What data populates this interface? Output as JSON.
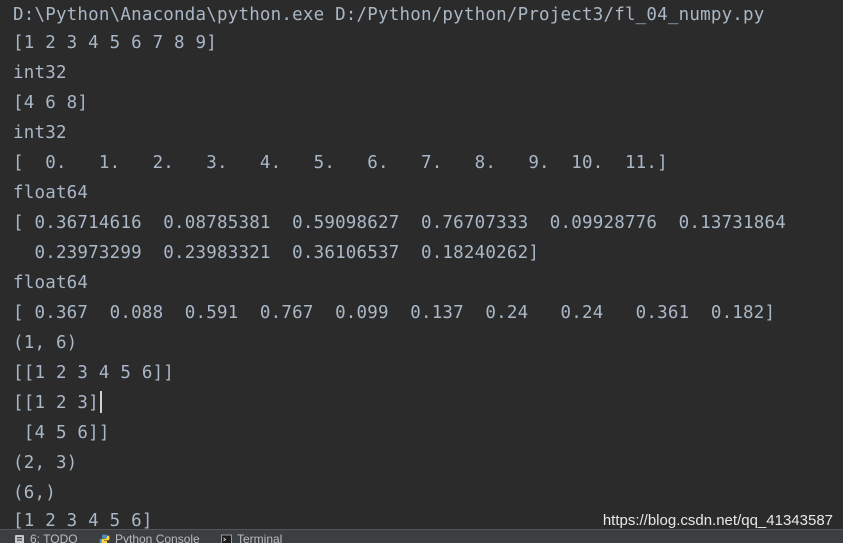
{
  "console": {
    "lines": [
      "D:\\Python\\Anaconda\\python.exe D:/Python/python/Project3/fl_04_numpy.py",
      "[1 2 3 4 5 6 7 8 9]",
      "int32",
      "[4 6 8]",
      "int32",
      "[  0.   1.   2.   3.   4.   5.   6.   7.   8.   9.  10.  11.]",
      "float64",
      "[ 0.36714616  0.08785381  0.59098627  0.76707333  0.09928776  0.13731864",
      "  0.23973299  0.23983321  0.36106537  0.18240262]",
      "float64",
      "[ 0.367  0.088  0.591  0.767  0.099  0.137  0.24   0.24   0.361  0.182]",
      "(1, 6)",
      "[[1 2 3 4 5 6]]",
      "[[1 2 3]",
      " [4 5 6]]",
      "(2, 3)",
      "(6,)",
      "[1 2 3 4 5 6]"
    ]
  },
  "watermark": "https://blog.csdn.net/qq_41343587",
  "toolbar": {
    "tabs": [
      {
        "label": "6: TODO",
        "icon": "todo-icon"
      },
      {
        "label": "Python Console",
        "icon": "python-icon"
      },
      {
        "label": "Terminal",
        "icon": "terminal-icon"
      }
    ]
  }
}
